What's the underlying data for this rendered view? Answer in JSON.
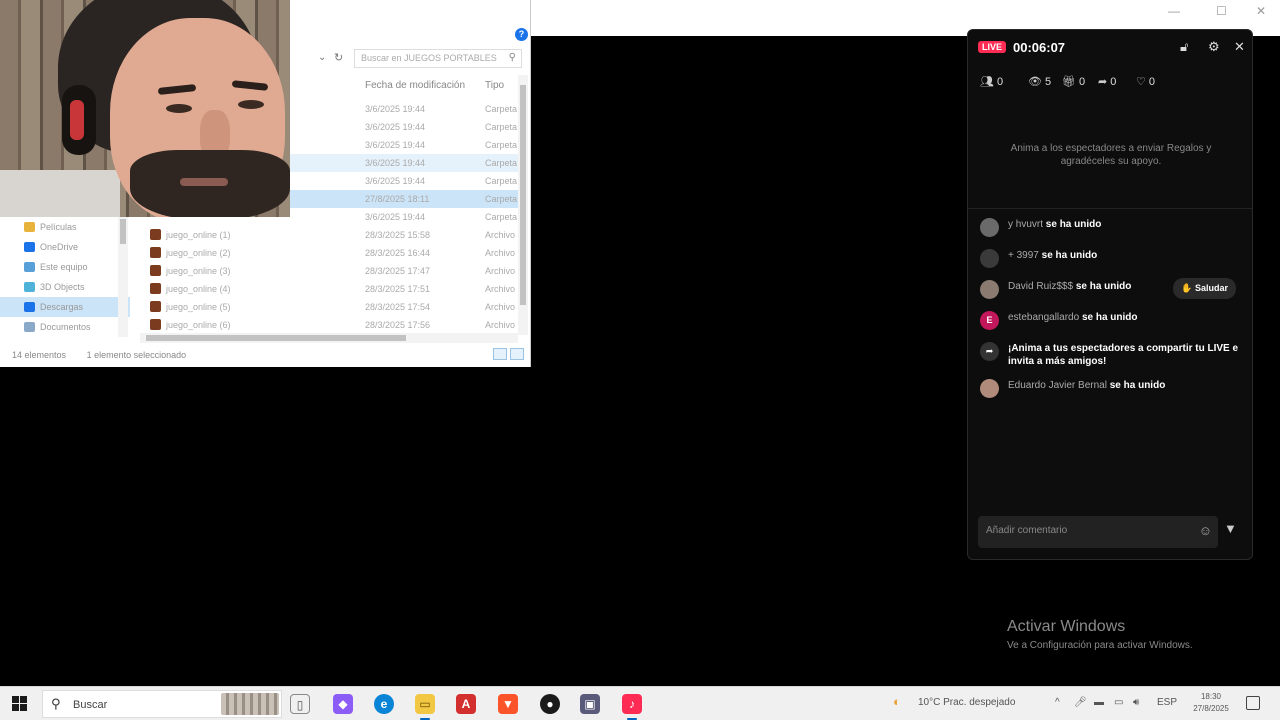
{
  "explorer": {
    "search_placeholder": "Buscar en JUEGOS PORTABLES",
    "columns": {
      "date": "Fecha de modificación",
      "type": "Tipo"
    },
    "folder_rows": [
      {
        "date": "3/6/2025 19:44",
        "type": "Carpeta"
      },
      {
        "date": "3/6/2025 19:44",
        "type": "Carpeta"
      },
      {
        "date": "3/6/2025 19:44",
        "type": "Carpeta"
      },
      {
        "date": "3/6/2025 19:44",
        "type": "Carpeta"
      },
      {
        "date": "3/6/2025 19:44",
        "type": "Carpeta"
      },
      {
        "date": "27/8/2025 18:11",
        "type": "Carpeta"
      },
      {
        "date": "3/6/2025 19:44",
        "type": "Carpeta"
      }
    ],
    "file_rows": [
      {
        "name": "juego_online (1)",
        "date": "28/3/2025 15:58",
        "type": "Archivo"
      },
      {
        "name": "juego_online (2)",
        "date": "28/3/2025 16:44",
        "type": "Archivo"
      },
      {
        "name": "juego_online (3)",
        "date": "28/3/2025 17:47",
        "type": "Archivo"
      },
      {
        "name": "juego_online (4)",
        "date": "28/3/2025 17:51",
        "type": "Archivo"
      },
      {
        "name": "juego_online (5)",
        "date": "28/3/2025 17:54",
        "type": "Archivo"
      },
      {
        "name": "juego_online (6)",
        "date": "28/3/2025 17:56",
        "type": "Archivo"
      }
    ],
    "nav_items": [
      {
        "label": "Películas",
        "color": "#e8b33a"
      },
      {
        "label": "OneDrive",
        "color": "#1a73e8"
      },
      {
        "label": "Este equipo",
        "color": "#5aa0d8"
      },
      {
        "label": "3D Objects",
        "color": "#4fb3d9"
      },
      {
        "label": "Descargas",
        "color": "#1a73e8"
      },
      {
        "label": "Documentos",
        "color": "#8aa8c8"
      }
    ],
    "status_count": "14 elementos",
    "status_selected": "1 elemento seleccionado"
  },
  "live": {
    "badge": "LIVE",
    "timer": "00:06:07",
    "stats": [
      {
        "icon": "people",
        "value": "0"
      },
      {
        "icon": "eye",
        "value": "5"
      },
      {
        "icon": "gift",
        "value": "0"
      },
      {
        "icon": "share",
        "value": "0"
      },
      {
        "icon": "heart",
        "value": "0"
      }
    ],
    "promo": "Anima a los espectadores a enviar Regalos y agradéceles su apoyo.",
    "messages": [
      {
        "user": "y hvuvrt",
        "action": "se ha unido",
        "avatar": ""
      },
      {
        "user": "+ 3997",
        "action": "se ha unido",
        "avatar": ""
      },
      {
        "user": "David Ruiz$$$",
        "action": "se ha unido",
        "avatar": ""
      },
      {
        "user": "estebangallardo",
        "action": "se ha unido",
        "avatar": "E"
      },
      {
        "user": "Eduardo Javier Bernal",
        "action": "se ha unido",
        "avatar": ""
      }
    ],
    "system_message": "¡Anima a tus espectadores a compartir tu LIVE e invita a más amigos!",
    "salute_label": "Saludar",
    "comment_placeholder": "Añadir comentario",
    "accent": "#fe2c55"
  },
  "activate": {
    "title": "Activar Windows",
    "subtitle": "Ve a Configuración para activar Windows."
  },
  "taskbar": {
    "search_label": "Buscar",
    "weather": "10°C  Prac. despejado",
    "lang": "ESP",
    "time": "18:30",
    "date": "27/8/2025"
  }
}
